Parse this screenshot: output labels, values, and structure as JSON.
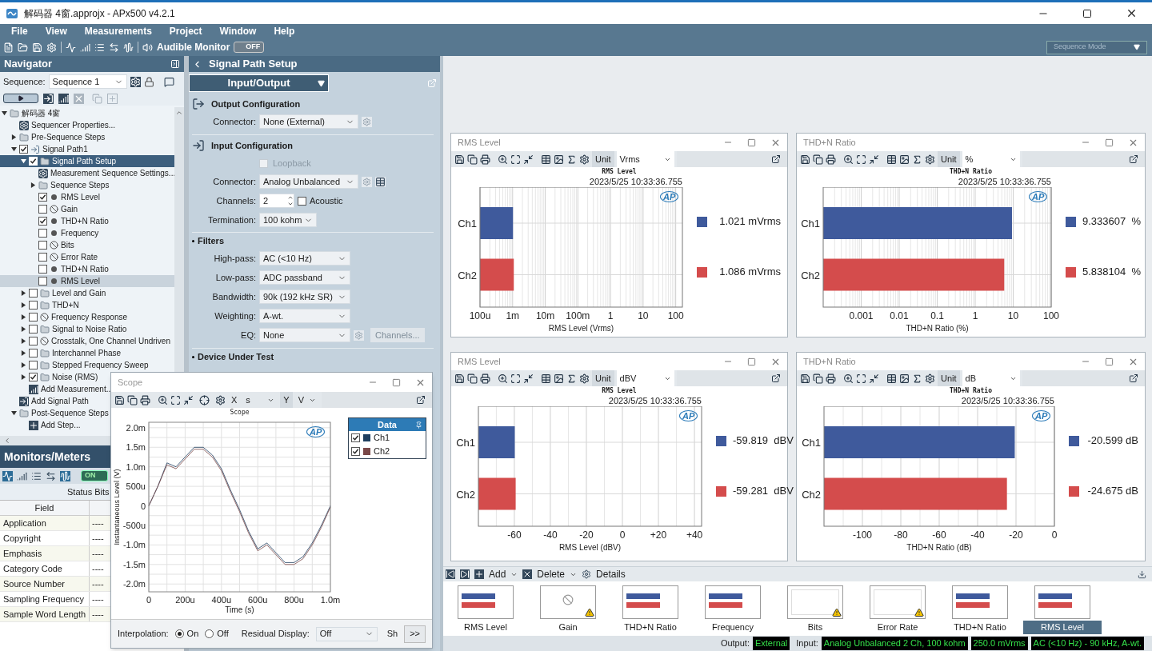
{
  "window": {
    "title": "解码器 4窗.approjx - APx500 v4.2.1"
  },
  "menu": [
    "File",
    "View",
    "Measurements",
    "Project",
    "Window",
    "Help"
  ],
  "toolbar": {
    "audible_monitor": {
      "label": "Audible Monitor",
      "toggle": "OFF",
      "on": false
    },
    "mode": {
      "value": "Sequence Mode",
      "disabled": true
    }
  },
  "navigator": {
    "title": "Navigator",
    "sequence_label": "Sequence:",
    "sequence": "Sequence 1",
    "tree": [
      {
        "label": "解码器 4窗",
        "kind": "folder",
        "expanded": true,
        "selected": false,
        "hovered": false,
        "children": [
          {
            "label": "Sequencer Properties...",
            "kind": "gear",
            "selected": false,
            "hovered": false
          },
          {
            "label": "Pre-Sequence Steps",
            "kind": "folder",
            "expanded": false,
            "selected": false,
            "hovered": false
          },
          {
            "label": "Signal Path1",
            "kind": "signal-path",
            "expanded": true,
            "checked": true,
            "selected": false,
            "hovered": false,
            "children": [
              {
                "label": "Signal Path Setup",
                "kind": "folder",
                "expanded": true,
                "checked": true,
                "selected": true,
                "hovered": false,
                "children": [
                  {
                    "label": "Measurement Sequence Settings...",
                    "kind": "gear",
                    "selected": false,
                    "hovered": false
                  },
                  {
                    "label": "Sequence Steps",
                    "kind": "folder",
                    "expanded": false,
                    "selected": false,
                    "hovered": false
                  },
                  {
                    "label": "RMS Level",
                    "kind": "dot",
                    "checked": true,
                    "selected": false,
                    "hovered": false
                  },
                  {
                    "label": "Gain",
                    "kind": "no",
                    "checked": false,
                    "selected": false,
                    "hovered": false
                  },
                  {
                    "label": "THD+N Ratio",
                    "kind": "dot",
                    "checked": true,
                    "selected": false,
                    "hovered": false
                  },
                  {
                    "label": "Frequency",
                    "kind": "dot",
                    "checked": false,
                    "selected": false,
                    "hovered": false
                  },
                  {
                    "label": "Bits",
                    "kind": "no",
                    "checked": false,
                    "selected": false,
                    "hovered": false
                  },
                  {
                    "label": "Error Rate",
                    "kind": "no",
                    "checked": false,
                    "selected": false,
                    "hovered": false
                  },
                  {
                    "label": "THD+N Ratio",
                    "kind": "dot",
                    "checked": false,
                    "selected": false,
                    "hovered": false
                  },
                  {
                    "label": "RMS Level",
                    "kind": "dot",
                    "checked": false,
                    "selected": false,
                    "hovered": true
                  }
                ]
              },
              {
                "label": "Level and Gain",
                "kind": "folder",
                "expanded": false,
                "checked": false,
                "selected": false,
                "hovered": false
              },
              {
                "label": "THD+N",
                "kind": "folder",
                "expanded": false,
                "checked": false,
                "selected": false,
                "hovered": false
              },
              {
                "label": "Frequency Response",
                "kind": "no",
                "expanded": false,
                "checked": false,
                "selected": false,
                "hovered": false
              },
              {
                "label": "Signal to Noise Ratio",
                "kind": "folder",
                "expanded": false,
                "checked": false,
                "selected": false,
                "hovered": false
              },
              {
                "label": "Crosstalk, One Channel Undriven",
                "kind": "no",
                "expanded": false,
                "checked": false,
                "selected": false,
                "hovered": false
              },
              {
                "label": "Interchannel Phase",
                "kind": "folder",
                "expanded": false,
                "checked": false,
                "selected": false,
                "hovered": false
              },
              {
                "label": "Stepped Frequency Sweep",
                "kind": "folder",
                "expanded": false,
                "checked": false,
                "selected": false,
                "hovered": false
              },
              {
                "label": "Noise (RMS)",
                "kind": "folder",
                "expanded": false,
                "checked": true,
                "selected": false,
                "hovered": false
              },
              {
                "label": "Add Measurement...",
                "kind": "chart",
                "selected": false,
                "hovered": false
              }
            ]
          },
          {
            "label": "Add Signal Path",
            "kind": "add-path",
            "selected": false,
            "hovered": false
          },
          {
            "label": "Post-Sequence Steps",
            "kind": "folder",
            "expanded": true,
            "selected": false,
            "hovered": false,
            "children": [
              {
                "label": "Add Step...",
                "kind": "plus",
                "selected": false,
                "hovered": false
              }
            ]
          }
        ]
      }
    ]
  },
  "monitors": {
    "title": "Monitors/Meters",
    "toggle": "ON",
    "on": true,
    "tab": "Status Bits",
    "column": "Field",
    "rows": [
      {
        "field": "Application",
        "value": "----"
      },
      {
        "field": "Copyright",
        "value": "----"
      },
      {
        "field": "Emphasis",
        "value": "----"
      },
      {
        "field": "Category Code",
        "value": "----"
      },
      {
        "field": "Source Number",
        "value": "----"
      },
      {
        "field": "Sampling Frequency",
        "value": "----"
      },
      {
        "field": "Sample Word Length",
        "value": "----"
      }
    ]
  },
  "signal_path": {
    "title": "Signal Path Setup",
    "view": "Input/Output",
    "output": {
      "title": "Output Configuration",
      "connector": {
        "label": "Connector:",
        "value": "None (External)"
      }
    },
    "input": {
      "title": "Input Configuration",
      "loopback": {
        "label": "Loopback",
        "checked": false,
        "disabled": true
      },
      "connector": {
        "label": "Connector:",
        "value": "Analog Unbalanced"
      },
      "channels": {
        "label": "Channels:",
        "value": "2"
      },
      "acoustic": {
        "label": "Acoustic",
        "checked": false
      },
      "termination": {
        "label": "Termination:",
        "value": "100 kohm"
      }
    },
    "filters": {
      "title": "Filters",
      "rows": [
        {
          "label": "High-pass:",
          "value": "AC (<10 Hz)"
        },
        {
          "label": "Low-pass:",
          "value": "ADC passband"
        },
        {
          "label": "Bandwidth:",
          "value": "90k (192 kHz SR)"
        },
        {
          "label": "Weighting:",
          "value": "A-wt."
        },
        {
          "label": "EQ:",
          "value": "None"
        }
      ],
      "channels_button": {
        "label": "Channels...",
        "disabled": true
      }
    },
    "dut": {
      "title": "Device Under Test"
    }
  },
  "scope": {
    "title": "Scope",
    "x_label": "X",
    "x_unit": "s",
    "y_label": "Y",
    "y_unit": "V",
    "logo": "AP",
    "plot_title": "Scope",
    "x_ticks": [
      "0",
      "200u",
      "400u",
      "600u",
      "800u",
      "1.0m"
    ],
    "y_ticks": [
      "2.0m",
      "1.5m",
      "1.0m",
      "500u",
      "0",
      "-500u",
      "-1.0m",
      "-1.5m",
      "-2.0m"
    ],
    "x_axis_label": "Time (s)",
    "y_axis_label": "Instantaneous Level (V)",
    "legend": {
      "title": "Data",
      "items": [
        {
          "name": "Ch1",
          "checked": true,
          "color": "#1f3f5f"
        },
        {
          "name": "Ch2",
          "checked": true,
          "color": "#7a4848"
        }
      ]
    },
    "interpolation": {
      "label": "Interpolation:",
      "options": [
        {
          "label": "On",
          "selected": true
        },
        {
          "label": "Off",
          "selected": false
        }
      ]
    },
    "residual": {
      "label": "Residual Display:",
      "value": "Off"
    },
    "cut_label": "Sh",
    "more_button": ">>"
  },
  "charts": [
    {
      "title": "RMS Level",
      "unit_label": "Unit",
      "unit": "Vrms",
      "timestamp": "2023/5/25 10:33:36.755",
      "logo": "AP",
      "plot_title": "RMS Level",
      "x_ticks": [
        "100u",
        "1m",
        "10m",
        "100m",
        "1",
        "10",
        "100"
      ],
      "x_axis_label": "RMS Level (Vrms)",
      "bars": [
        {
          "name": "Ch1",
          "color": "#3f5a9c",
          "level": 0.163
        },
        {
          "name": "Ch2",
          "color": "#d44c4c",
          "level": 0.167
        }
      ],
      "legend": [
        {
          "color": "#3f5a9c",
          "reading": "1.021 mVrms"
        },
        {
          "color": "#d44c4c",
          "reading": "1.086 mVrms"
        }
      ]
    },
    {
      "title": "THD+N Ratio",
      "unit_label": "Unit",
      "unit": "%",
      "timestamp": "2023/5/25 10:33:36.755",
      "logo": "AP",
      "plot_title": "THD+N Ratio",
      "x_ticks": [
        "0.001",
        "0.01",
        "0.1",
        "1",
        "10",
        "100"
      ],
      "x_axis_label": "THD+N Ratio (%)",
      "bars": [
        {
          "name": "Ch1",
          "color": "#3f5a9c",
          "level": 0.828
        },
        {
          "name": "Ch2",
          "color": "#d44c4c",
          "level": 0.794
        }
      ],
      "legend": [
        {
          "color": "#3f5a9c",
          "reading": "9.333607  %"
        },
        {
          "color": "#d44c4c",
          "reading": "5.838104  %"
        }
      ]
    },
    {
      "title": "RMS Level",
      "unit_label": "Unit",
      "unit": "dBV",
      "timestamp": "2023/5/25 10:33:36.755",
      "logo": "AP",
      "plot_title": "RMS Level",
      "x_ticks": [
        "-60",
        "-40",
        "-20",
        "0",
        "+20",
        "+40"
      ],
      "x_axis_label": "RMS Level (dBV)",
      "bars": [
        {
          "name": "Ch1",
          "color": "#3f5a9c",
          "level": 0.163
        },
        {
          "name": "Ch2",
          "color": "#d44c4c",
          "level": 0.167
        }
      ],
      "legend": [
        {
          "color": "#3f5a9c",
          "reading": "-59.819  dBV"
        },
        {
          "color": "#d44c4c",
          "reading": "-59.281  dBV"
        }
      ]
    },
    {
      "title": "THD+N Ratio",
      "unit_label": "Unit",
      "unit": "dB",
      "timestamp": "2023/5/25 10:33:36.755",
      "logo": "AP",
      "plot_title": "THD+N Ratio",
      "x_ticks": [
        "-100",
        "-80",
        "-60",
        "-40",
        "-20",
        "0"
      ],
      "x_axis_label": "THD+N Ratio (dB)",
      "bars": [
        {
          "name": "Ch1",
          "color": "#3f5a9c",
          "level": 0.828
        },
        {
          "name": "Ch2",
          "color": "#d44c4c",
          "level": 0.794
        }
      ],
      "legend": [
        {
          "color": "#3f5a9c",
          "reading": "-20.599 dB"
        },
        {
          "color": "#d44c4c",
          "reading": "-24.675 dB"
        }
      ]
    }
  ],
  "ribbon": {
    "add": "Add",
    "delete": "Delete",
    "details": "Details",
    "items": [
      {
        "label": "RMS Level",
        "kind": "bars",
        "warning": false,
        "selected": false
      },
      {
        "label": "Gain",
        "kind": "no-data",
        "warning": true,
        "selected": false
      },
      {
        "label": "THD+N Ratio",
        "kind": "bars",
        "warning": false,
        "selected": false
      },
      {
        "label": "Frequency",
        "kind": "bars",
        "warning": false,
        "selected": false
      },
      {
        "label": "Bits",
        "kind": "empty",
        "warning": true,
        "selected": false
      },
      {
        "label": "Error Rate",
        "kind": "empty",
        "warning": true,
        "selected": false
      },
      {
        "label": "THD+N Ratio",
        "kind": "bars",
        "warning": false,
        "selected": false
      },
      {
        "label": "RMS Level",
        "kind": "bars",
        "warning": false,
        "selected": true
      }
    ]
  },
  "status_bar": {
    "output_label": "Output:",
    "output": "External",
    "input_label": "Input:",
    "input": [
      "Analog Unbalanced 2 Ch, 100 kohm",
      "250.0 mVrms",
      "AC (<10 Hz) - 90 kHz, A-wt."
    ]
  }
}
